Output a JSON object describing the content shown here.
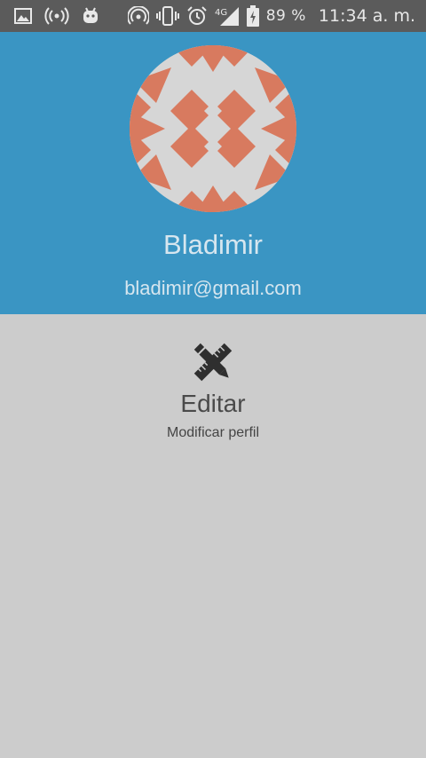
{
  "status_bar": {
    "icons_left": [
      "image-icon",
      "hotspot-icon",
      "android-icon"
    ],
    "icons_right": [
      "nfc-icon",
      "vibrate-icon",
      "alarm-icon",
      "signal-4g-icon",
      "battery-charging-icon"
    ],
    "network_label": "4G",
    "battery_text": "89 %",
    "time": "11:34 a. m."
  },
  "profile": {
    "name": "Bladimir",
    "email": "bladimir@gmail.com",
    "header_color": "#3a95c3",
    "avatar_colors": [
      "#d6d6d6",
      "#d87a5f"
    ]
  },
  "edit_action": {
    "icon": "ruler-pencil-icon",
    "title": "Editar",
    "subtitle": "Modificar perfil"
  }
}
